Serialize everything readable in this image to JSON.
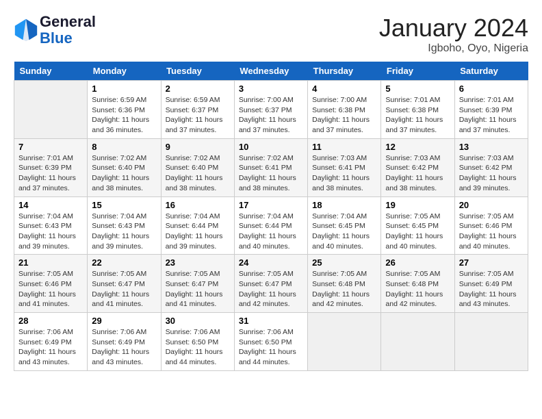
{
  "header": {
    "logo_line1": "General",
    "logo_line2": "Blue",
    "month_title": "January 2024",
    "location": "Igboho, Oyo, Nigeria"
  },
  "days_of_week": [
    "Sunday",
    "Monday",
    "Tuesday",
    "Wednesday",
    "Thursday",
    "Friday",
    "Saturday"
  ],
  "weeks": [
    [
      {
        "day": "",
        "empty": true
      },
      {
        "day": "1",
        "sunrise": "6:59 AM",
        "sunset": "6:36 PM",
        "daylight": "11 hours and 36 minutes."
      },
      {
        "day": "2",
        "sunrise": "6:59 AM",
        "sunset": "6:37 PM",
        "daylight": "11 hours and 37 minutes."
      },
      {
        "day": "3",
        "sunrise": "7:00 AM",
        "sunset": "6:37 PM",
        "daylight": "11 hours and 37 minutes."
      },
      {
        "day": "4",
        "sunrise": "7:00 AM",
        "sunset": "6:38 PM",
        "daylight": "11 hours and 37 minutes."
      },
      {
        "day": "5",
        "sunrise": "7:01 AM",
        "sunset": "6:38 PM",
        "daylight": "11 hours and 37 minutes."
      },
      {
        "day": "6",
        "sunrise": "7:01 AM",
        "sunset": "6:39 PM",
        "daylight": "11 hours and 37 minutes."
      }
    ],
    [
      {
        "day": "7",
        "sunrise": "7:01 AM",
        "sunset": "6:39 PM",
        "daylight": "11 hours and 37 minutes."
      },
      {
        "day": "8",
        "sunrise": "7:02 AM",
        "sunset": "6:40 PM",
        "daylight": "11 hours and 38 minutes."
      },
      {
        "day": "9",
        "sunrise": "7:02 AM",
        "sunset": "6:40 PM",
        "daylight": "11 hours and 38 minutes."
      },
      {
        "day": "10",
        "sunrise": "7:02 AM",
        "sunset": "6:41 PM",
        "daylight": "11 hours and 38 minutes."
      },
      {
        "day": "11",
        "sunrise": "7:03 AM",
        "sunset": "6:41 PM",
        "daylight": "11 hours and 38 minutes."
      },
      {
        "day": "12",
        "sunrise": "7:03 AM",
        "sunset": "6:42 PM",
        "daylight": "11 hours and 38 minutes."
      },
      {
        "day": "13",
        "sunrise": "7:03 AM",
        "sunset": "6:42 PM",
        "daylight": "11 hours and 39 minutes."
      }
    ],
    [
      {
        "day": "14",
        "sunrise": "7:04 AM",
        "sunset": "6:43 PM",
        "daylight": "11 hours and 39 minutes."
      },
      {
        "day": "15",
        "sunrise": "7:04 AM",
        "sunset": "6:43 PM",
        "daylight": "11 hours and 39 minutes."
      },
      {
        "day": "16",
        "sunrise": "7:04 AM",
        "sunset": "6:44 PM",
        "daylight": "11 hours and 39 minutes."
      },
      {
        "day": "17",
        "sunrise": "7:04 AM",
        "sunset": "6:44 PM",
        "daylight": "11 hours and 40 minutes."
      },
      {
        "day": "18",
        "sunrise": "7:04 AM",
        "sunset": "6:45 PM",
        "daylight": "11 hours and 40 minutes."
      },
      {
        "day": "19",
        "sunrise": "7:05 AM",
        "sunset": "6:45 PM",
        "daylight": "11 hours and 40 minutes."
      },
      {
        "day": "20",
        "sunrise": "7:05 AM",
        "sunset": "6:46 PM",
        "daylight": "11 hours and 40 minutes."
      }
    ],
    [
      {
        "day": "21",
        "sunrise": "7:05 AM",
        "sunset": "6:46 PM",
        "daylight": "11 hours and 41 minutes."
      },
      {
        "day": "22",
        "sunrise": "7:05 AM",
        "sunset": "6:47 PM",
        "daylight": "11 hours and 41 minutes."
      },
      {
        "day": "23",
        "sunrise": "7:05 AM",
        "sunset": "6:47 PM",
        "daylight": "11 hours and 41 minutes."
      },
      {
        "day": "24",
        "sunrise": "7:05 AM",
        "sunset": "6:47 PM",
        "daylight": "11 hours and 42 minutes."
      },
      {
        "day": "25",
        "sunrise": "7:05 AM",
        "sunset": "6:48 PM",
        "daylight": "11 hours and 42 minutes."
      },
      {
        "day": "26",
        "sunrise": "7:05 AM",
        "sunset": "6:48 PM",
        "daylight": "11 hours and 42 minutes."
      },
      {
        "day": "27",
        "sunrise": "7:05 AM",
        "sunset": "6:49 PM",
        "daylight": "11 hours and 43 minutes."
      }
    ],
    [
      {
        "day": "28",
        "sunrise": "7:06 AM",
        "sunset": "6:49 PM",
        "daylight": "11 hours and 43 minutes."
      },
      {
        "day": "29",
        "sunrise": "7:06 AM",
        "sunset": "6:49 PM",
        "daylight": "11 hours and 43 minutes."
      },
      {
        "day": "30",
        "sunrise": "7:06 AM",
        "sunset": "6:50 PM",
        "daylight": "11 hours and 44 minutes."
      },
      {
        "day": "31",
        "sunrise": "7:06 AM",
        "sunset": "6:50 PM",
        "daylight": "11 hours and 44 minutes."
      },
      {
        "day": "",
        "empty": true
      },
      {
        "day": "",
        "empty": true
      },
      {
        "day": "",
        "empty": true
      }
    ]
  ]
}
